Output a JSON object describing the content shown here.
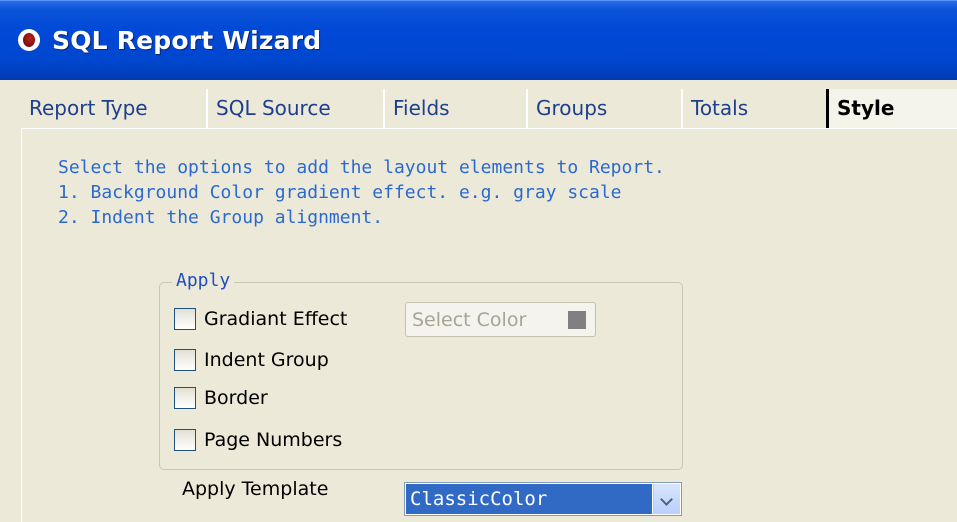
{
  "window": {
    "title": "SQL Report Wizard",
    "icon": "app-icon"
  },
  "tabs": [
    {
      "label": "Report Type",
      "active": false
    },
    {
      "label": "SQL Source",
      "active": false
    },
    {
      "label": "Fields",
      "active": false
    },
    {
      "label": "Groups",
      "active": false
    },
    {
      "label": "Totals",
      "active": false
    },
    {
      "label": "Style",
      "active": true
    }
  ],
  "instructions": {
    "line1": "Select the options to add the layout elements to Report.",
    "line2": "1. Background Color gradient effect. e.g. gray scale",
    "line3": "2. Indent the Group alignment."
  },
  "apply_group": {
    "legend": "Apply",
    "options": [
      {
        "label": "Gradiant Effect",
        "checked": false
      },
      {
        "label": "Indent Group",
        "checked": false
      },
      {
        "label": "Border",
        "checked": false
      },
      {
        "label": "Page Numbers",
        "checked": false
      }
    ],
    "color_button": {
      "label": "Select Color",
      "swatch_color": "#808080",
      "enabled": false
    }
  },
  "template": {
    "label": "Apply Template",
    "selected": "ClassicColor"
  },
  "colors": {
    "titlebar": "#0047cf",
    "accent": "#316ac5",
    "instruction_text": "#2a6ad0",
    "background": "#ece9d8"
  }
}
